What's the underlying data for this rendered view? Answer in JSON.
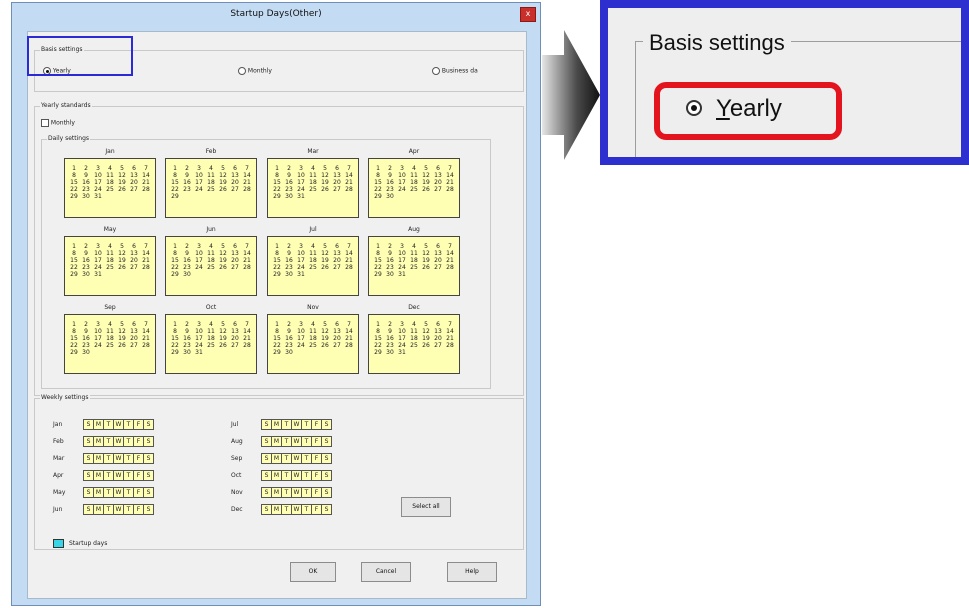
{
  "window": {
    "title": "Startup Days(Other)",
    "close_glyph": "x"
  },
  "basis": {
    "label": "Basis settings",
    "options": [
      {
        "label": "Yearly",
        "selected": true
      },
      {
        "label": "Monthly",
        "selected": false
      },
      {
        "label": "Business da",
        "selected": false
      }
    ]
  },
  "yearly_standards": {
    "label": "Yearly standards",
    "monthly_checkbox": "Monthly",
    "daily_settings_label": "Daily settings",
    "months": [
      {
        "name": "Jan",
        "days": 31
      },
      {
        "name": "Feb",
        "days": 29
      },
      {
        "name": "Mar",
        "days": 31
      },
      {
        "name": "Apr",
        "days": 30
      },
      {
        "name": "May",
        "days": 31
      },
      {
        "name": "Jun",
        "days": 30
      },
      {
        "name": "Jul",
        "days": 31
      },
      {
        "name": "Aug",
        "days": 31
      },
      {
        "name": "Sep",
        "days": 30
      },
      {
        "name": "Oct",
        "days": 31
      },
      {
        "name": "Nov",
        "days": 30
      },
      {
        "name": "Dec",
        "days": 31
      }
    ]
  },
  "weekly": {
    "label": "Weekly settings",
    "months_left": [
      "Jan",
      "Feb",
      "Mar",
      "Apr",
      "May",
      "Jun"
    ],
    "months_right": [
      "Jul",
      "Aug",
      "Sep",
      "Oct",
      "Nov",
      "Dec"
    ],
    "day_letters": [
      "S",
      "M",
      "T",
      "W",
      "T",
      "F",
      "S"
    ],
    "select_all": "Select all"
  },
  "legend": {
    "label": "Startup days",
    "color": "#37d6e6"
  },
  "buttons": {
    "ok": "OK",
    "cancel": "Cancel",
    "help": "Help"
  },
  "zoom": {
    "group_label": "Basis settings",
    "first_letter": "Y",
    "rest": "early"
  },
  "colors": {
    "calendar_fill": "#ffffb3",
    "highlight_frame": "#2d2fcf",
    "highlight_ring": "#e3141e"
  }
}
